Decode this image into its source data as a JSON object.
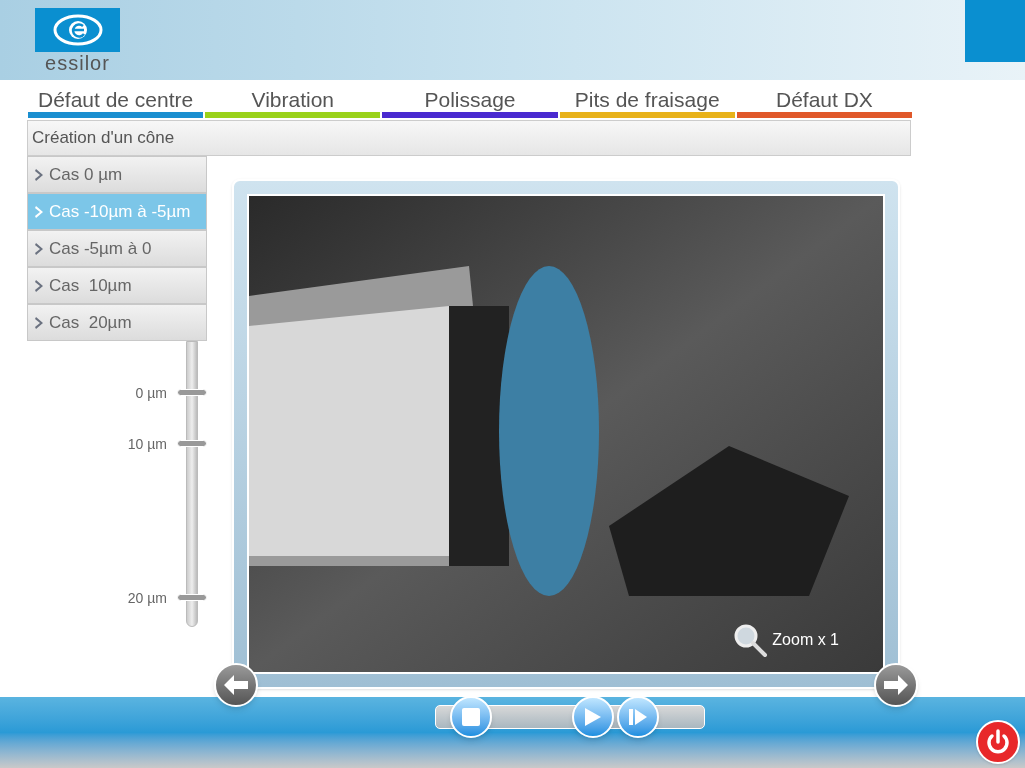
{
  "logo": {
    "wordmark": "essilor"
  },
  "tabs": [
    {
      "label": "Défaut de centre",
      "color": "#1a8fd0",
      "selected": false
    },
    {
      "label": "Vibration",
      "color": "#9ad21a",
      "selected": false
    },
    {
      "label": "Polissage",
      "color": "#4a2ad0",
      "selected": false
    },
    {
      "label": "Pits de fraisage",
      "color": "#e8b21a",
      "selected": false
    },
    {
      "label": "Défaut DX",
      "color": "#e0582a",
      "selected": false
    }
  ],
  "section_title": "Création d'un cône",
  "cases": [
    {
      "label": "Cas 0 µm",
      "selected": false
    },
    {
      "label": "Cas -10µm à -5µm",
      "selected": true
    },
    {
      "label": "Cas -5µm à 0",
      "selected": false
    },
    {
      "label": "Cas  10µm",
      "selected": false
    },
    {
      "label": "Cas  20µm",
      "selected": false
    }
  ],
  "scale_ticks": [
    "0 µm",
    "10 µm",
    "20 µm"
  ],
  "video": {
    "zoom_label": "Zoom x 1"
  }
}
